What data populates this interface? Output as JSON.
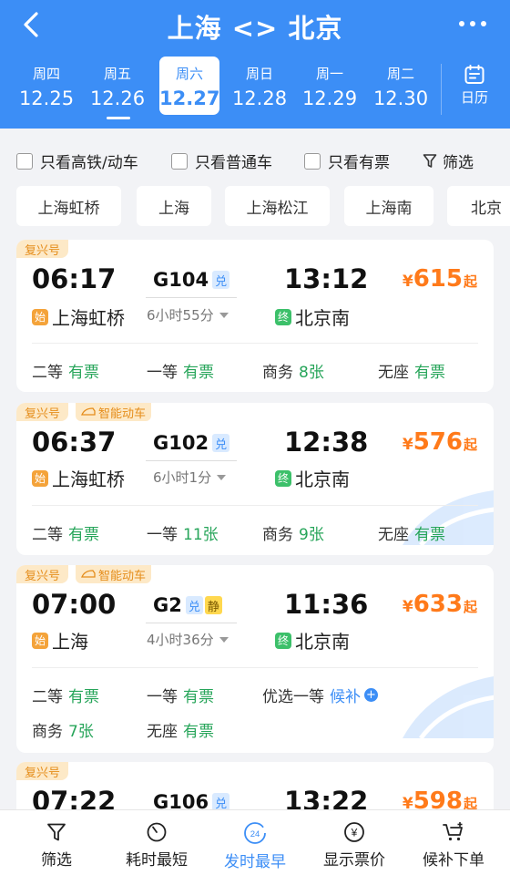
{
  "header": {
    "title": "上海 <> 北京",
    "back_icon": "back-chevron-icon",
    "more_icon": "more-dots-icon",
    "bg_color": "#3c8ef6"
  },
  "dates": [
    {
      "weekday": "周四",
      "date": "12.25"
    },
    {
      "weekday": "周五",
      "date": "12.26"
    },
    {
      "weekday": "周六",
      "date": "12.27",
      "active": true
    },
    {
      "weekday": "周日",
      "date": "12.28"
    },
    {
      "weekday": "周一",
      "date": "12.29"
    },
    {
      "weekday": "周二",
      "date": "12.30"
    }
  ],
  "calendar": {
    "label": "日历",
    "icon": "calendar-icon"
  },
  "filters": {
    "high_speed": "只看高铁/动车",
    "regular": "只看普通车",
    "available": "只看有票",
    "filter": "筛选"
  },
  "stations": [
    "上海虹桥",
    "上海",
    "上海松江",
    "上海南",
    "北京"
  ],
  "trains": [
    {
      "tags": [
        "复兴号"
      ],
      "dep_time": "06:17",
      "train_no": "G104",
      "badges": [
        "兑"
      ],
      "arr_time": "13:12",
      "duration": "6小时55分",
      "from_badge": "始",
      "from": "上海虹桥",
      "to_badge": "终",
      "to": "北京南",
      "price_cur": "¥",
      "price": "615",
      "price_suffix": "起",
      "seats": [
        {
          "name": "二等",
          "value": "有票"
        },
        {
          "name": "一等",
          "value": "有票"
        },
        {
          "name": "商务",
          "value": "8张"
        },
        {
          "name": "无座",
          "value": "有票"
        }
      ]
    },
    {
      "tags": [
        "复兴号",
        "智能动车"
      ],
      "dep_time": "06:37",
      "train_no": "G102",
      "badges": [
        "兑"
      ],
      "arr_time": "12:38",
      "duration": "6小时1分",
      "from_badge": "始",
      "from": "上海虹桥",
      "to_badge": "终",
      "to": "北京南",
      "price_cur": "¥",
      "price": "576",
      "price_suffix": "起",
      "seats": [
        {
          "name": "二等",
          "value": "有票"
        },
        {
          "name": "一等",
          "value": "11张"
        },
        {
          "name": "商务",
          "value": "9张"
        },
        {
          "name": "无座",
          "value": "有票"
        }
      ]
    },
    {
      "tags": [
        "复兴号",
        "智能动车"
      ],
      "dep_time": "07:00",
      "train_no": "G2",
      "badges": [
        "兑",
        "静"
      ],
      "arr_time": "11:36",
      "duration": "4小时36分",
      "from_badge": "始",
      "from": "上海",
      "to_badge": "终",
      "to": "北京南",
      "price_cur": "¥",
      "price": "633",
      "price_suffix": "起",
      "seats": [
        {
          "name": "二等",
          "value": "有票"
        },
        {
          "name": "一等",
          "value": "有票"
        },
        {
          "name": "优选一等",
          "value": "候补"
        },
        {
          "name": "商务",
          "value": "7张"
        },
        {
          "name": "无座",
          "value": "有票"
        }
      ]
    },
    {
      "tags": [
        "复兴号"
      ],
      "dep_time": "07:22",
      "train_no": "G106",
      "badges": [
        "兑"
      ],
      "arr_time": "13:22",
      "price_cur": "¥",
      "price": "598",
      "price_suffix": "起"
    }
  ],
  "bottom_nav": [
    {
      "label": "筛选",
      "icon": "filter-icon"
    },
    {
      "label": "耗时最短",
      "icon": "timer-icon"
    },
    {
      "label": "发时最早",
      "icon": "clock-24-icon",
      "active": true,
      "icon_text": "24"
    },
    {
      "label": "显示票价",
      "icon": "yuan-icon",
      "icon_text": "¥"
    },
    {
      "label": "候补下单",
      "icon": "cart-plus-icon"
    }
  ],
  "colors": {
    "accent": "#3c8ef6",
    "price": "#ff7a1a",
    "available": "#27a55a",
    "tag_text": "#e58d1b",
    "tag_bg": "#fde9c7"
  }
}
